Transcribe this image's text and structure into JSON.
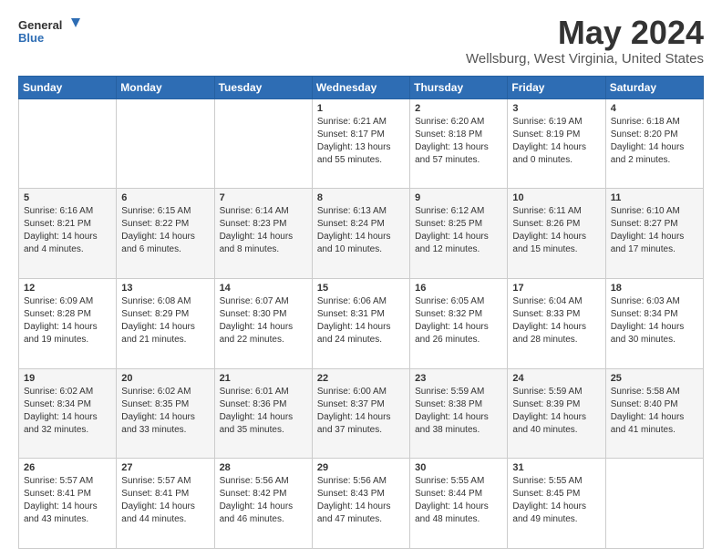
{
  "logo": {
    "line1": "General",
    "line2": "Blue"
  },
  "title": "May 2024",
  "subtitle": "Wellsburg, West Virginia, United States",
  "days_header": [
    "Sunday",
    "Monday",
    "Tuesday",
    "Wednesday",
    "Thursday",
    "Friday",
    "Saturday"
  ],
  "weeks": [
    [
      {
        "day": "",
        "sunrise": "",
        "sunset": "",
        "daylight": ""
      },
      {
        "day": "",
        "sunrise": "",
        "sunset": "",
        "daylight": ""
      },
      {
        "day": "",
        "sunrise": "",
        "sunset": "",
        "daylight": ""
      },
      {
        "day": "1",
        "sunrise": "Sunrise: 6:21 AM",
        "sunset": "Sunset: 8:17 PM",
        "daylight": "Daylight: 13 hours and 55 minutes."
      },
      {
        "day": "2",
        "sunrise": "Sunrise: 6:20 AM",
        "sunset": "Sunset: 8:18 PM",
        "daylight": "Daylight: 13 hours and 57 minutes."
      },
      {
        "day": "3",
        "sunrise": "Sunrise: 6:19 AM",
        "sunset": "Sunset: 8:19 PM",
        "daylight": "Daylight: 14 hours and 0 minutes."
      },
      {
        "day": "4",
        "sunrise": "Sunrise: 6:18 AM",
        "sunset": "Sunset: 8:20 PM",
        "daylight": "Daylight: 14 hours and 2 minutes."
      }
    ],
    [
      {
        "day": "5",
        "sunrise": "Sunrise: 6:16 AM",
        "sunset": "Sunset: 8:21 PM",
        "daylight": "Daylight: 14 hours and 4 minutes."
      },
      {
        "day": "6",
        "sunrise": "Sunrise: 6:15 AM",
        "sunset": "Sunset: 8:22 PM",
        "daylight": "Daylight: 14 hours and 6 minutes."
      },
      {
        "day": "7",
        "sunrise": "Sunrise: 6:14 AM",
        "sunset": "Sunset: 8:23 PM",
        "daylight": "Daylight: 14 hours and 8 minutes."
      },
      {
        "day": "8",
        "sunrise": "Sunrise: 6:13 AM",
        "sunset": "Sunset: 8:24 PM",
        "daylight": "Daylight: 14 hours and 10 minutes."
      },
      {
        "day": "9",
        "sunrise": "Sunrise: 6:12 AM",
        "sunset": "Sunset: 8:25 PM",
        "daylight": "Daylight: 14 hours and 12 minutes."
      },
      {
        "day": "10",
        "sunrise": "Sunrise: 6:11 AM",
        "sunset": "Sunset: 8:26 PM",
        "daylight": "Daylight: 14 hours and 15 minutes."
      },
      {
        "day": "11",
        "sunrise": "Sunrise: 6:10 AM",
        "sunset": "Sunset: 8:27 PM",
        "daylight": "Daylight: 14 hours and 17 minutes."
      }
    ],
    [
      {
        "day": "12",
        "sunrise": "Sunrise: 6:09 AM",
        "sunset": "Sunset: 8:28 PM",
        "daylight": "Daylight: 14 hours and 19 minutes."
      },
      {
        "day": "13",
        "sunrise": "Sunrise: 6:08 AM",
        "sunset": "Sunset: 8:29 PM",
        "daylight": "Daylight: 14 hours and 21 minutes."
      },
      {
        "day": "14",
        "sunrise": "Sunrise: 6:07 AM",
        "sunset": "Sunset: 8:30 PM",
        "daylight": "Daylight: 14 hours and 22 minutes."
      },
      {
        "day": "15",
        "sunrise": "Sunrise: 6:06 AM",
        "sunset": "Sunset: 8:31 PM",
        "daylight": "Daylight: 14 hours and 24 minutes."
      },
      {
        "day": "16",
        "sunrise": "Sunrise: 6:05 AM",
        "sunset": "Sunset: 8:32 PM",
        "daylight": "Daylight: 14 hours and 26 minutes."
      },
      {
        "day": "17",
        "sunrise": "Sunrise: 6:04 AM",
        "sunset": "Sunset: 8:33 PM",
        "daylight": "Daylight: 14 hours and 28 minutes."
      },
      {
        "day": "18",
        "sunrise": "Sunrise: 6:03 AM",
        "sunset": "Sunset: 8:34 PM",
        "daylight": "Daylight: 14 hours and 30 minutes."
      }
    ],
    [
      {
        "day": "19",
        "sunrise": "Sunrise: 6:02 AM",
        "sunset": "Sunset: 8:34 PM",
        "daylight": "Daylight: 14 hours and 32 minutes."
      },
      {
        "day": "20",
        "sunrise": "Sunrise: 6:02 AM",
        "sunset": "Sunset: 8:35 PM",
        "daylight": "Daylight: 14 hours and 33 minutes."
      },
      {
        "day": "21",
        "sunrise": "Sunrise: 6:01 AM",
        "sunset": "Sunset: 8:36 PM",
        "daylight": "Daylight: 14 hours and 35 minutes."
      },
      {
        "day": "22",
        "sunrise": "Sunrise: 6:00 AM",
        "sunset": "Sunset: 8:37 PM",
        "daylight": "Daylight: 14 hours and 37 minutes."
      },
      {
        "day": "23",
        "sunrise": "Sunrise: 5:59 AM",
        "sunset": "Sunset: 8:38 PM",
        "daylight": "Daylight: 14 hours and 38 minutes."
      },
      {
        "day": "24",
        "sunrise": "Sunrise: 5:59 AM",
        "sunset": "Sunset: 8:39 PM",
        "daylight": "Daylight: 14 hours and 40 minutes."
      },
      {
        "day": "25",
        "sunrise": "Sunrise: 5:58 AM",
        "sunset": "Sunset: 8:40 PM",
        "daylight": "Daylight: 14 hours and 41 minutes."
      }
    ],
    [
      {
        "day": "26",
        "sunrise": "Sunrise: 5:57 AM",
        "sunset": "Sunset: 8:41 PM",
        "daylight": "Daylight: 14 hours and 43 minutes."
      },
      {
        "day": "27",
        "sunrise": "Sunrise: 5:57 AM",
        "sunset": "Sunset: 8:41 PM",
        "daylight": "Daylight: 14 hours and 44 minutes."
      },
      {
        "day": "28",
        "sunrise": "Sunrise: 5:56 AM",
        "sunset": "Sunset: 8:42 PM",
        "daylight": "Daylight: 14 hours and 46 minutes."
      },
      {
        "day": "29",
        "sunrise": "Sunrise: 5:56 AM",
        "sunset": "Sunset: 8:43 PM",
        "daylight": "Daylight: 14 hours and 47 minutes."
      },
      {
        "day": "30",
        "sunrise": "Sunrise: 5:55 AM",
        "sunset": "Sunset: 8:44 PM",
        "daylight": "Daylight: 14 hours and 48 minutes."
      },
      {
        "day": "31",
        "sunrise": "Sunrise: 5:55 AM",
        "sunset": "Sunset: 8:45 PM",
        "daylight": "Daylight: 14 hours and 49 minutes."
      },
      {
        "day": "",
        "sunrise": "",
        "sunset": "",
        "daylight": ""
      }
    ]
  ]
}
